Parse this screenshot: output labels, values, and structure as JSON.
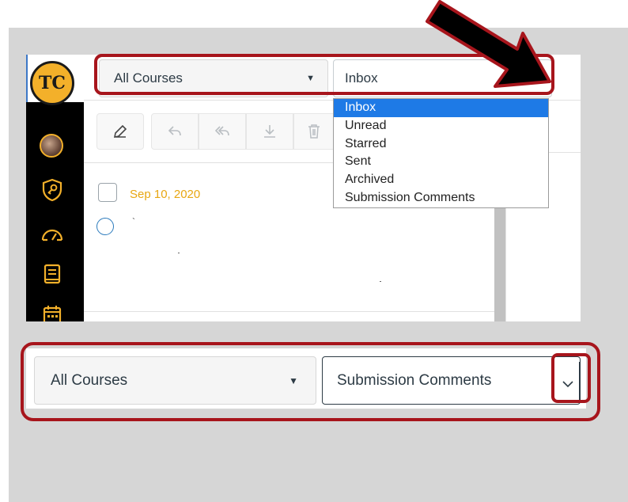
{
  "top": {
    "logo_text": "TC",
    "course_select": "All Courses",
    "mailbox_select": "Inbox",
    "date": "Sep 10, 2020",
    "snippet_char": "`",
    "dropdown_options": [
      "Inbox",
      "Unread",
      "Starred",
      "Sent",
      "Archived",
      "Submission Comments"
    ],
    "selected_option": "Inbox"
  },
  "bottom": {
    "course_select": "All Courses",
    "mailbox_select": "Submission Comments"
  },
  "icons": {
    "compose": "pencil-icon",
    "reply": "reply-icon",
    "reply_all": "reply-all-icon",
    "archive": "download-icon",
    "delete": "trash-icon",
    "rail": [
      "avatar",
      "shield-key-icon",
      "dashboard-icon",
      "book-icon",
      "calendar-icon"
    ]
  },
  "colors": {
    "highlight": "#a7151c",
    "rail": "#000000",
    "accent_gold": "#f3b02a",
    "date_text": "#e8a712",
    "dropdown_selected": "#1e7ae6"
  }
}
